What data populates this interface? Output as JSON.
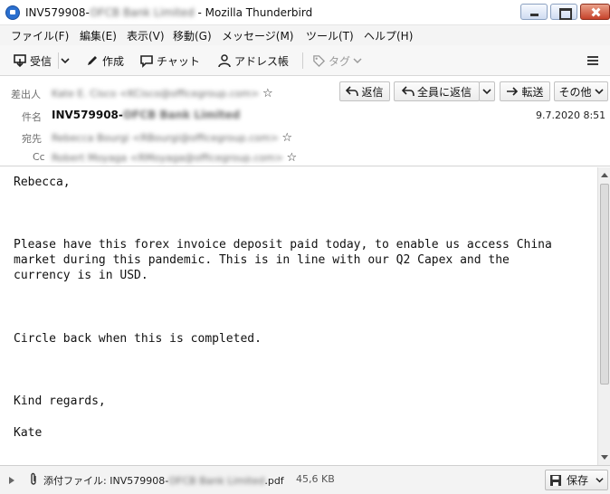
{
  "window": {
    "title_prefix": "INV579908-",
    "title_blurred": "OFCB Bank Limited",
    "title_suffix": " - Mozilla Thunderbird"
  },
  "menu": [
    "ファイル(F)",
    "編集(E)",
    "表示(V)",
    "移動(G)",
    "メッセージ(M)",
    "ツール(T)",
    "ヘルプ(H)"
  ],
  "toolbar": {
    "get_mail": "受信",
    "write": "作成",
    "chat": "チャット",
    "address_book": "アドレス帳",
    "tag": "タグ"
  },
  "header": {
    "from_label": "差出人",
    "from_blurred": "Kate E. Cisco <KCisco@officegroup.com>",
    "subject_label": "件名",
    "subject_prefix": "INV579908-",
    "subject_blurred": "OFCB Bank Limited",
    "to_label": "宛先",
    "to_blurred": "Rebecca Bourgi <RBourgi@officegroup.com>",
    "cc_label": "Cc",
    "cc_blurred": "Robert Moyaga <RMoyaga@officegroup.com>",
    "date": "9.7.2020 8:51",
    "reply": "返信",
    "reply_all": "全員に返信",
    "forward": "転送",
    "other": "その他"
  },
  "body": {
    "lines": [
      "Rebecca,",
      "Please have this forex invoice deposit paid today, to enable us access China",
      "market during this pandemic. This is in line with our Q2 Capex and the",
      "currency is in USD.",
      "Circle back when this is completed.",
      "Kind regards,",
      "Kate"
    ]
  },
  "attachment": {
    "label": "添付ファイル:",
    "name_prefix": " INV579908-",
    "name_blurred": "OFCB Bank Limited",
    "name_suffix": ".pdf",
    "size": "45,6 KB",
    "save": "保存"
  },
  "colors": {
    "accent": "#2a6fcf",
    "close_button": "#c7432b"
  }
}
